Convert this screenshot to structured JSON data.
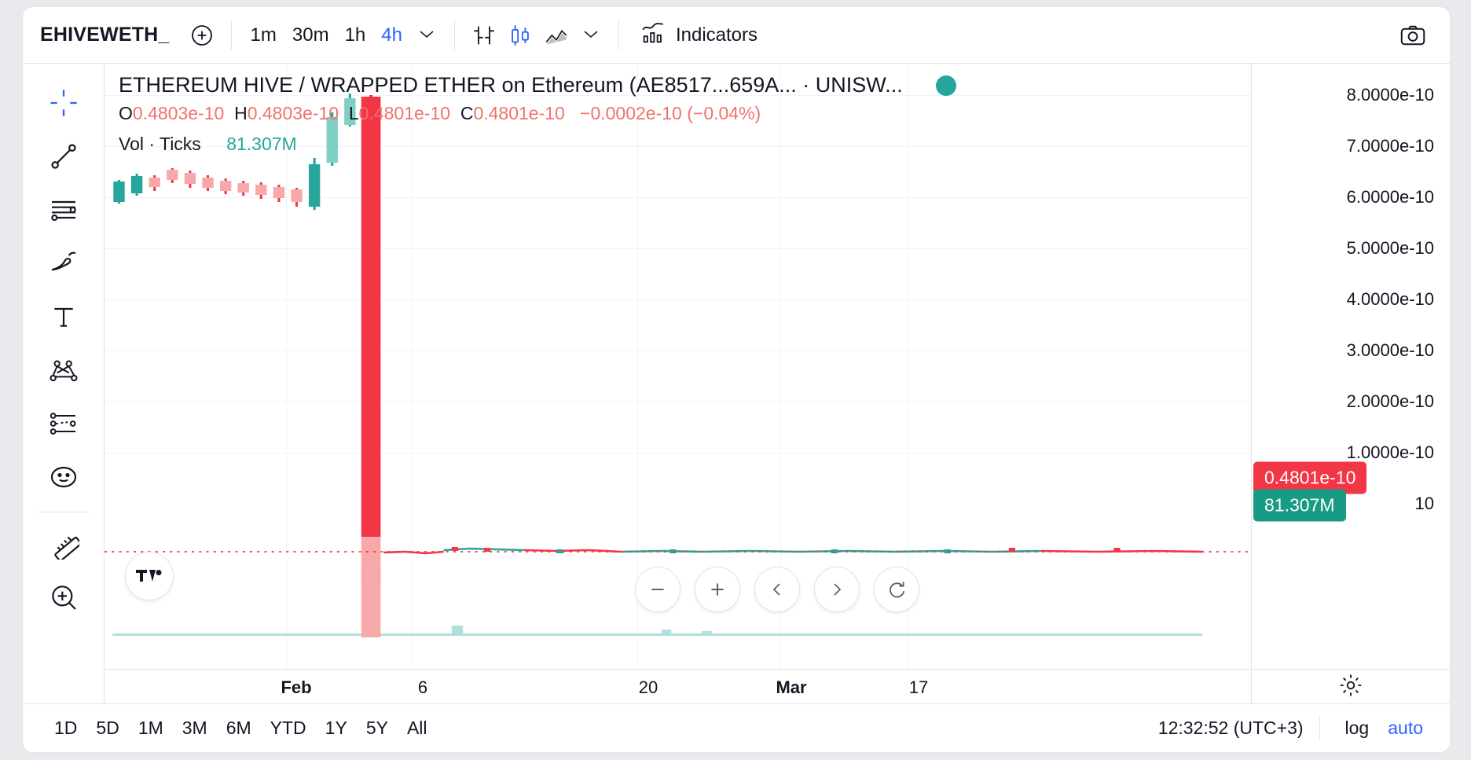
{
  "toolbar": {
    "symbol": "EHIVEWETH_",
    "add_symbol_icon": "plus-circle-icon",
    "timeframes": [
      {
        "label": "1m",
        "active": false
      },
      {
        "label": "30m",
        "active": false
      },
      {
        "label": "1h",
        "active": false
      },
      {
        "label": "4h",
        "active": true
      }
    ],
    "timeframe_chevron": "chevron-down-icon",
    "chart_types": [
      {
        "name": "bar-chart-icon",
        "active": false
      },
      {
        "name": "candlestick-chart-icon",
        "active": true
      },
      {
        "name": "area-chart-icon",
        "active": false
      }
    ],
    "chart_type_chevron": "chevron-down-icon",
    "indicators_label": "Indicators",
    "indicators_icon": "indicators-icon",
    "snapshot_icon": "camera-icon"
  },
  "drawing_rail": [
    {
      "name": "crosshair-tool-icon",
      "active": true
    },
    {
      "name": "trend-line-tool-icon",
      "active": false
    },
    {
      "name": "horizontal-lines-tool-icon",
      "active": false
    },
    {
      "name": "brush-tool-icon",
      "active": false
    },
    {
      "name": "text-tool-icon",
      "active": false
    },
    {
      "name": "patterns-tool-icon",
      "active": false
    },
    {
      "name": "prediction-tool-icon",
      "active": false
    },
    {
      "name": "emoji-tool-icon",
      "active": false
    },
    {
      "name": "measure-tool-icon",
      "active": false
    },
    {
      "name": "zoom-in-tool-icon",
      "active": false
    }
  ],
  "legend": {
    "title": "ETHEREUM HIVE / WRAPPED ETHER on Ethereum (AE8517...659A... · UNISW...",
    "live_status": "live-dot",
    "ohlc": [
      {
        "label": "O",
        "value": "0.4803e-10"
      },
      {
        "label": "H",
        "value": "0.4803e-10"
      },
      {
        "label": "L",
        "value": "0.4801e-10"
      },
      {
        "label": "C",
        "value": "0.4801e-10"
      }
    ],
    "change": "−0.0002e-10",
    "change_percent": "(−0.04%)",
    "volume_label": "Vol · Ticks",
    "volume_value": "81.307M"
  },
  "chart_controls": {
    "zoom_out": "minus-icon",
    "zoom_in": "plus-icon",
    "scroll_left": "chevron-left-icon",
    "scroll_right": "chevron-right-icon",
    "reset": "reset-icon"
  },
  "price_axis": {
    "ticks": [
      "8.0000e-10",
      "7.0000e-10",
      "6.0000e-10",
      "5.0000e-10",
      "4.0000e-10",
      "3.0000e-10",
      "2.0000e-10",
      "1.0000e-10"
    ],
    "partial_tick": "10",
    "price_badge": "0.4801e-10",
    "volume_badge": "81.307M",
    "settings_icon": "gear-icon"
  },
  "time_axis": {
    "ticks": [
      {
        "label": "Feb",
        "bold": true
      },
      {
        "label": "6",
        "bold": false
      },
      {
        "label": "20",
        "bold": false
      },
      {
        "label": "Mar",
        "bold": true
      },
      {
        "label": "17",
        "bold": false
      }
    ]
  },
  "bottom_bar": {
    "ranges": [
      "1D",
      "5D",
      "1M",
      "3M",
      "6M",
      "YTD",
      "1Y",
      "5Y",
      "All"
    ],
    "clock": "12:32:52 (UTC+3)",
    "log_label": "log",
    "auto_label": "auto"
  },
  "colors": {
    "accent": "#2962ff",
    "up": "#26a69a",
    "down": "#f23645",
    "down_text": "#f0736a",
    "grid": "#f0f3fa",
    "border": "#e0e3eb",
    "text": "#131722"
  },
  "chart_data": {
    "type": "candlestick",
    "title": "ETHEREUM HIVE / WRAPPED ETHER on Ethereum",
    "ylabel": "",
    "xlabel": "",
    "ylim": [
      0.0,
      8.5e-10
    ],
    "y_ticks": [
      8e-10,
      7e-10,
      6e-10,
      5e-10,
      4e-10,
      3e-10,
      2e-10,
      1e-10
    ],
    "x_ticks": [
      "Feb",
      "6",
      "20",
      "Mar",
      "17"
    ],
    "grid": true,
    "legend_position": "top-left",
    "last_price": 4.801e-11,
    "last_volume": "81.307M",
    "price_line": 4.801e-11,
    "candles": [
      {
        "x": 0.8,
        "o": 6.2e-10,
        "h": 6.55e-10,
        "l": 6.1e-10,
        "c": 6.45e-10,
        "dir": "up"
      },
      {
        "x": 1.6,
        "o": 6.45e-10,
        "h": 6.6e-10,
        "l": 6.35e-10,
        "c": 6.55e-10,
        "dir": "up"
      },
      {
        "x": 2.4,
        "o": 6.55e-10,
        "h": 6.62e-10,
        "l": 6.48e-10,
        "c": 6.52e-10,
        "dir": "down"
      },
      {
        "x": 3.2,
        "o": 6.52e-10,
        "h": 6.75e-10,
        "l": 6.5e-10,
        "c": 6.72e-10,
        "dir": "down"
      },
      {
        "x": 4.0,
        "o": 6.72e-10,
        "h": 6.78e-10,
        "l": 6.62e-10,
        "c": 6.66e-10,
        "dir": "down"
      },
      {
        "x": 5.0,
        "o": 6.66e-10,
        "h": 6.7e-10,
        "l": 6.55e-10,
        "c": 6.58e-10,
        "dir": "down"
      },
      {
        "x": 6.0,
        "o": 6.58e-10,
        "h": 6.64e-10,
        "l": 6.5e-10,
        "c": 6.54e-10,
        "dir": "down"
      },
      {
        "x": 7.0,
        "o": 6.54e-10,
        "h": 6.6e-10,
        "l": 6.45e-10,
        "c": 6.5e-10,
        "dir": "down"
      },
      {
        "x": 8.0,
        "o": 6.5e-10,
        "h": 6.58e-10,
        "l": 6.4e-10,
        "c": 6.44e-10,
        "dir": "down"
      },
      {
        "x": 9.0,
        "o": 6.44e-10,
        "h": 6.52e-10,
        "l": 6.3e-10,
        "c": 6.35e-10,
        "dir": "down"
      },
      {
        "x": 10.2,
        "o": 6.35e-10,
        "h": 6.4e-10,
        "l": 6.05e-10,
        "c": 6.1e-10,
        "dir": "up"
      },
      {
        "x": 11.0,
        "o": 6.1e-10,
        "h": 7.45e-10,
        "l": 6.05e-10,
        "c": 7.3e-10,
        "dir": "up"
      },
      {
        "x": 11.8,
        "o": 7.3e-10,
        "h": 8.2e-10,
        "l": 7.25e-10,
        "c": 8.1e-10,
        "dir": "up"
      },
      {
        "x": 12.6,
        "o": 8.1e-10,
        "h": 8.35e-10,
        "l": 4.9e-11,
        "c": 4.9e-11,
        "dir": "down"
      },
      {
        "x": 13.6,
        "o": 4.9e-11,
        "h": 5e-11,
        "l": 4.7e-11,
        "c": 4.8e-11,
        "dir": "down"
      }
    ],
    "flat_series_note": "Near-zero price series continues flat across remainder of range at ~0.48e-10",
    "volume_bars_note": "Low volume histogram along the bottom with a spike at the crash candle"
  }
}
